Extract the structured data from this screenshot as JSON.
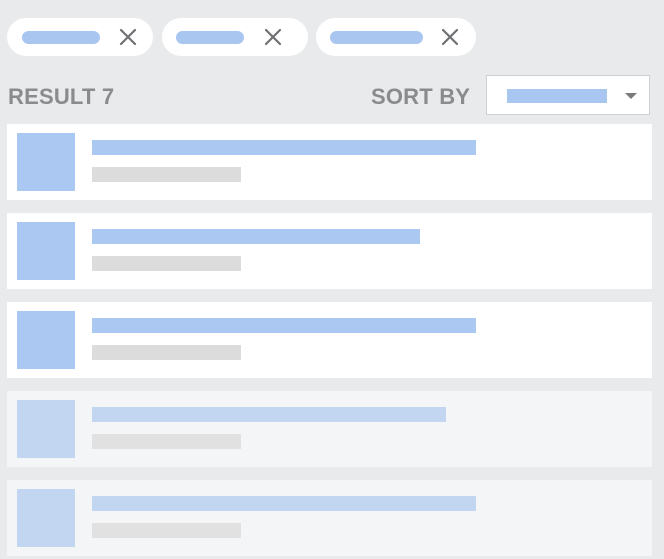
{
  "filters": {
    "chips": [
      {
        "name": "filter-chip-1",
        "close_icon": "close-icon"
      },
      {
        "name": "filter-chip-2",
        "close_icon": "close-icon"
      },
      {
        "name": "filter-chip-3",
        "close_icon": "close-icon"
      }
    ]
  },
  "results": {
    "label": "RESULT 7"
  },
  "sort": {
    "label": "SORT BY",
    "dropdown_icon": "chevron-down-icon"
  },
  "list": {
    "items": [
      {
        "style": "solid"
      },
      {
        "style": "solid"
      },
      {
        "style": "solid"
      },
      {
        "style": "faded"
      },
      {
        "style": "faded"
      }
    ]
  },
  "colors": {
    "background": "#e9eaec",
    "accent_placeholder": "#a9c6f0",
    "text_placeholder": "#dcdcdc",
    "label_text": "#8a8b8d"
  }
}
